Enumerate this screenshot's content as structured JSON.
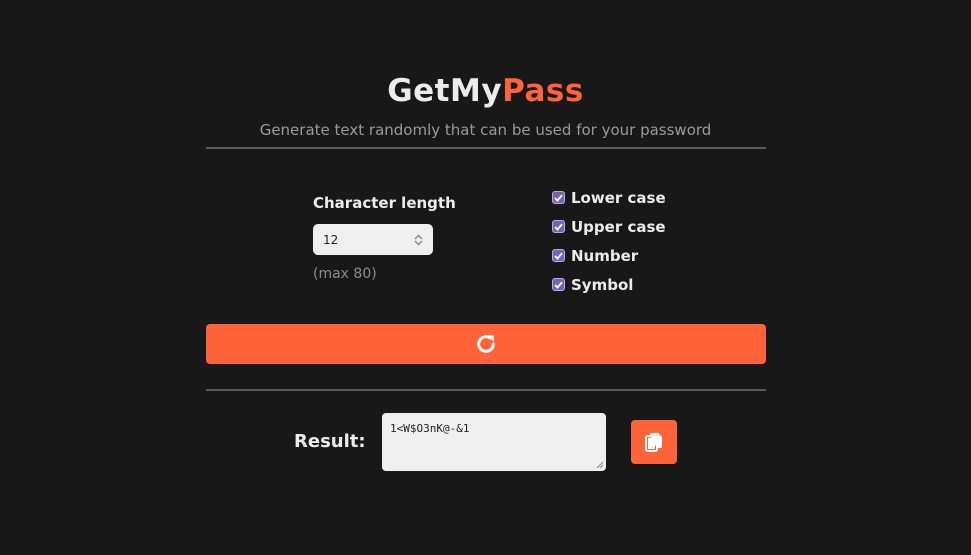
{
  "header": {
    "title_part1": "GetMy",
    "title_part2": "Pass",
    "subtitle": "Generate text randomly that can be used for your password"
  },
  "length": {
    "label": "Character length",
    "value": "12",
    "max_note": "(max 80)"
  },
  "options": [
    {
      "label": "Lower case",
      "checked": true
    },
    {
      "label": "Upper case",
      "checked": true
    },
    {
      "label": "Number",
      "checked": true
    },
    {
      "label": "Symbol",
      "checked": true
    }
  ],
  "generate": {
    "icon": "refresh-icon"
  },
  "result": {
    "label": "Result:",
    "value": "1<W$O3nK@-&1"
  },
  "copy": {
    "icon": "copy-icon"
  },
  "colors": {
    "background": "#181818",
    "accent": "#ff6339",
    "checkbox": "#7a61b8",
    "text": "#ececec",
    "muted": "#9a9a9a"
  }
}
